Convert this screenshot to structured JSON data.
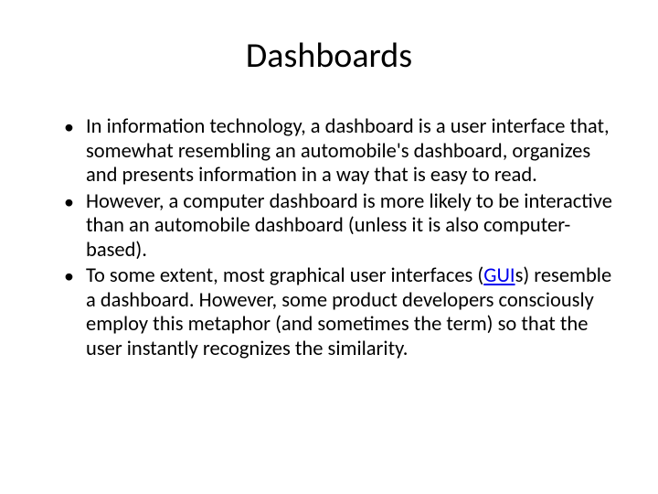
{
  "title": "Dashboards",
  "bullets": {
    "b0": "In information technology, a dashboard is a user interface that, somewhat resembling an automobile's dashboard, organizes and presents information in a way that is easy to read.",
    "b1": "However, a computer dashboard is more likely to be interactive than an automobile dashboard (unless it is also computer-based).",
    "b2_pre": " To some extent, most graphical user interfaces (",
    "b2_link": "GUI",
    "b2_post": "s) resemble a dashboard. However, some product developers consciously employ this metaphor (and sometimes the term) so that the user instantly recognizes the similarity."
  }
}
